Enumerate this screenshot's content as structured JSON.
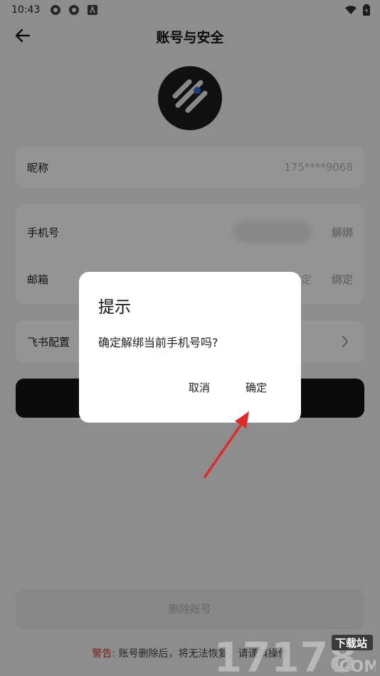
{
  "status_bar": {
    "time": "10:43"
  },
  "header": {
    "title": "账号与安全"
  },
  "profile": {
    "nickname_label": "昵称",
    "nickname_value": "175****9068"
  },
  "bindings": {
    "phone_label": "手机号",
    "phone_action": "解绑",
    "email_label": "邮箱",
    "email_status_partial": "定",
    "email_action": "绑定"
  },
  "feishu": {
    "label": "飞书配置"
  },
  "delete_button": "删除账号",
  "warning": {
    "label": "警告:",
    "text": " 账号删除后，将无法恢复，请谨慎操作"
  },
  "dialog": {
    "title": "提示",
    "message": "确定解绑当前手机号吗?",
    "cancel": "取消",
    "confirm": "确定"
  },
  "watermark": {
    "number": "17178",
    "site_label": "下载站",
    "domain": ".COM"
  },
  "colors": {
    "danger": "#d23232",
    "primary_dark": "#141414",
    "avatar_accent": "#2f6fe0"
  }
}
